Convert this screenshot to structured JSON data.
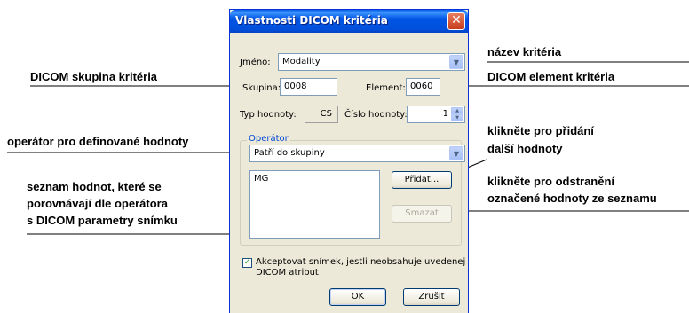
{
  "dialog": {
    "title": "Vlastnosti DICOM kritéria",
    "close_glyph": "✕",
    "name_label": "Jméno:",
    "name_value": "Modality",
    "group_label": "Skupina:",
    "group_value": "0008",
    "element_label": "Element:",
    "element_value": "0060",
    "value_type_label": "Typ hodnoty:",
    "value_type_value": "CS",
    "value_count_label": "Číslo hodnoty:",
    "value_count_value": "1",
    "operator_group_label": "Operátor",
    "operator_value": "Patří do skupiny",
    "values_list": [
      "MG"
    ],
    "add_button": "Přidat...",
    "delete_button": "Smazat",
    "accept_checkbox_checked": true,
    "accept_checkbox_line1": "Akceptovat snímek, jestli neobsahuje uvedenej",
    "accept_checkbox_line2": "DICOM atribut",
    "ok_button": "OK",
    "cancel_button": "Zrušit"
  },
  "annotations": {
    "criterion_name": "název kritéria",
    "dicom_group": "DICOM skupina kritéria",
    "dicom_element": "DICOM element kritéria",
    "operator": "operátor pro definované hodnoty",
    "add_line1": "klikněte pro přidání",
    "add_line2": "další hodnoty",
    "remove_line1": "klikněte pro odstranění",
    "remove_line2": "označené hodnoty ze seznamu",
    "values_line1": "seznam hodnot, které se",
    "values_line2": "porovnávají dle operátora",
    "values_line3": "s DICOM parametry snímku"
  }
}
